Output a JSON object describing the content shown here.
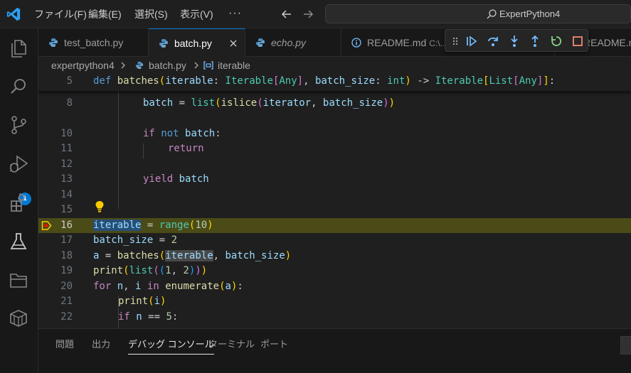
{
  "menu": {
    "file": "ファイル(F)",
    "edit": "編集(E)",
    "selection": "選択(S)",
    "view": "表示(V)",
    "more": "···"
  },
  "search": {
    "text": "ExpertPython4"
  },
  "activity": {
    "debug_badge": "1"
  },
  "tabs": [
    {
      "label": "test_batch.py"
    },
    {
      "label": "batch.py"
    },
    {
      "label": "echo.py"
    },
    {
      "label": "README.md",
      "desc": "C:\\..."
    },
    {
      "label": "README.md"
    }
  ],
  "breadcrumb": {
    "folder": "expertpython4",
    "file": "batch.py",
    "symbol": "iterable"
  },
  "editor": {
    "lines": {
      "l5": "5",
      "l8": "8",
      "l10": "10",
      "l11": "11",
      "l12": "12",
      "l13": "13",
      "l14": "14",
      "l15": "15",
      "l16": "16",
      "l17": "17",
      "l18": "18",
      "l19": "19",
      "l20": "20",
      "l21": "21",
      "l22": "22"
    },
    "code": {
      "c5": {
        "def": "def",
        "name": "batches",
        "p1": "(",
        "arg1": "iterable",
        "colon1": ": ",
        "t1": "Iterable",
        "b1": "[",
        "t2": "Any",
        "b2": "]",
        "comma": ", ",
        "arg2": "batch_size",
        "colon2": ": ",
        "t3": "int",
        "p2": ")",
        "arrow": " -> ",
        "t4": "Iterable",
        "b3": "[",
        "t5": "List",
        "b4": "[",
        "t6": "Any",
        "b5": "]",
        "b6": "]",
        "end": ":"
      },
      "c8": {
        "var": "batch",
        "eq": " = ",
        "list": "list",
        "p1": "(",
        "islice": "islice",
        "p2": "(",
        "iter": "iterator",
        "comma": ", ",
        "bs": "batch_size",
        "p3": ")",
        "p4": ")"
      },
      "c10": {
        "if": "if",
        "not": "not",
        "var": "batch",
        "colon": ":"
      },
      "c11": {
        "ret": "return"
      },
      "c13": {
        "yield": "yield",
        "var": "batch"
      },
      "c16": {
        "var": "iterable",
        "eq": " = ",
        "range": "range",
        "p1": "(",
        "num": "10",
        "p2": ")"
      },
      "c17": {
        "var": "batch_size",
        "eq": " = ",
        "num": "2"
      },
      "c18": {
        "var": "a",
        "eq": " = ",
        "fn": "batches",
        "p1": "(",
        "arg": "iterable",
        "comma": ", ",
        "arg2": "batch_size",
        "p2": ")"
      },
      "c19": {
        "print": "print",
        "p1": "(",
        "list": "list",
        "p2": "(",
        "p3": "(",
        "n1": "1",
        "comma": ", ",
        "n2": "2",
        "p4": ")",
        "p5": ")",
        "p6": ")"
      },
      "c20": {
        "for": "for",
        "n": "n",
        "comma": ", ",
        "i": "i",
        "in": "in",
        "enum": "enumerate",
        "p1": "(",
        "a": "a",
        "p2": ")",
        "colon": ":"
      },
      "c21": {
        "print": "print",
        "p1": "(",
        "i": "i",
        "p2": ")"
      },
      "c22": {
        "if": "if",
        "n": "n",
        "op": " == ",
        "num": "5",
        "colon": ":"
      }
    }
  },
  "panel": {
    "tabs": [
      "問題",
      "出力",
      "デバッグ コンソール",
      "ターミナル",
      "ポート"
    ]
  }
}
